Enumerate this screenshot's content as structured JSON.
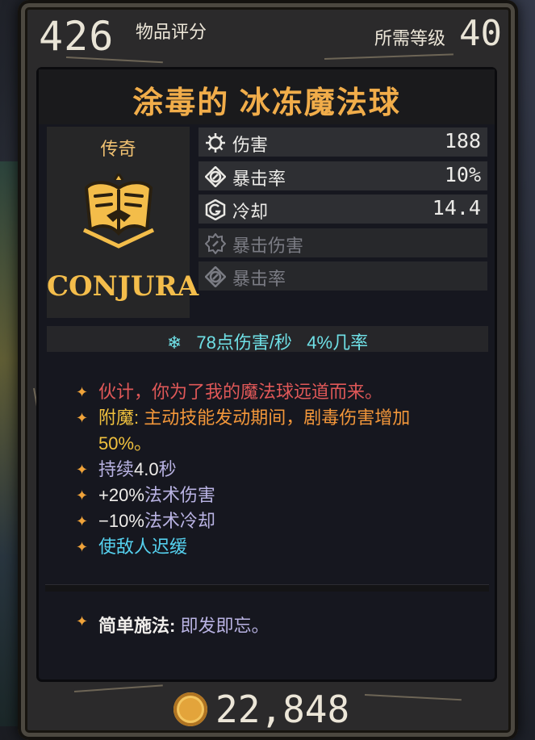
{
  "header": {
    "item_score_value": "426",
    "item_score_label": "物品评分",
    "required_level_label": "所需等级",
    "required_level_value": "40"
  },
  "item": {
    "name": "涂毒的 冰冻魔法球",
    "rarity": "传奇",
    "brand": "CONJURA",
    "icon": "spellbook-icon"
  },
  "stats": [
    {
      "icon": "damage-icon",
      "label": "伤害",
      "value": "188",
      "active": true
    },
    {
      "icon": "crit-chance-icon",
      "label": "暴击率",
      "value": "10%",
      "active": true
    },
    {
      "icon": "cooldown-icon",
      "label": "冷却",
      "value": "14.4",
      "active": true
    },
    {
      "icon": "crit-damage-icon",
      "label": "暴击伤害",
      "value": "",
      "active": false
    },
    {
      "icon": "crit-chance-icon",
      "label": "暴击率",
      "value": "",
      "active": false
    }
  ],
  "dps": {
    "icon": "frost-snowflake-icon",
    "text": "78点伤害/秒",
    "chance": "4%几率"
  },
  "effects": {
    "flavor": "伙计，你为了我的魔法球远道而来。",
    "enchant_label": "附魔:",
    "enchant_text": "主动技能发动期间，剧毒伤害增加",
    "enchant_value": "50%。",
    "duration_label": "持续",
    "duration_value": "4.0",
    "duration_unit": "秒",
    "spell_damage_value": "+20%",
    "spell_damage_label": "法术伤害",
    "spell_cooldown_value": "−10%",
    "spell_cooldown_label": "法术冷却",
    "slow": "使敌人迟缓"
  },
  "cast": {
    "label": "简单施法:",
    "value": "即发即忘。"
  },
  "price": {
    "icon": "coin-icon",
    "value": "22,848"
  },
  "colors": {
    "title": "#f1ad4a",
    "rarity": "#f1c272",
    "dps": "#6fe0e6",
    "flavor": "#e05858",
    "enchant": "#f3973a",
    "slow": "#55d1ef"
  }
}
